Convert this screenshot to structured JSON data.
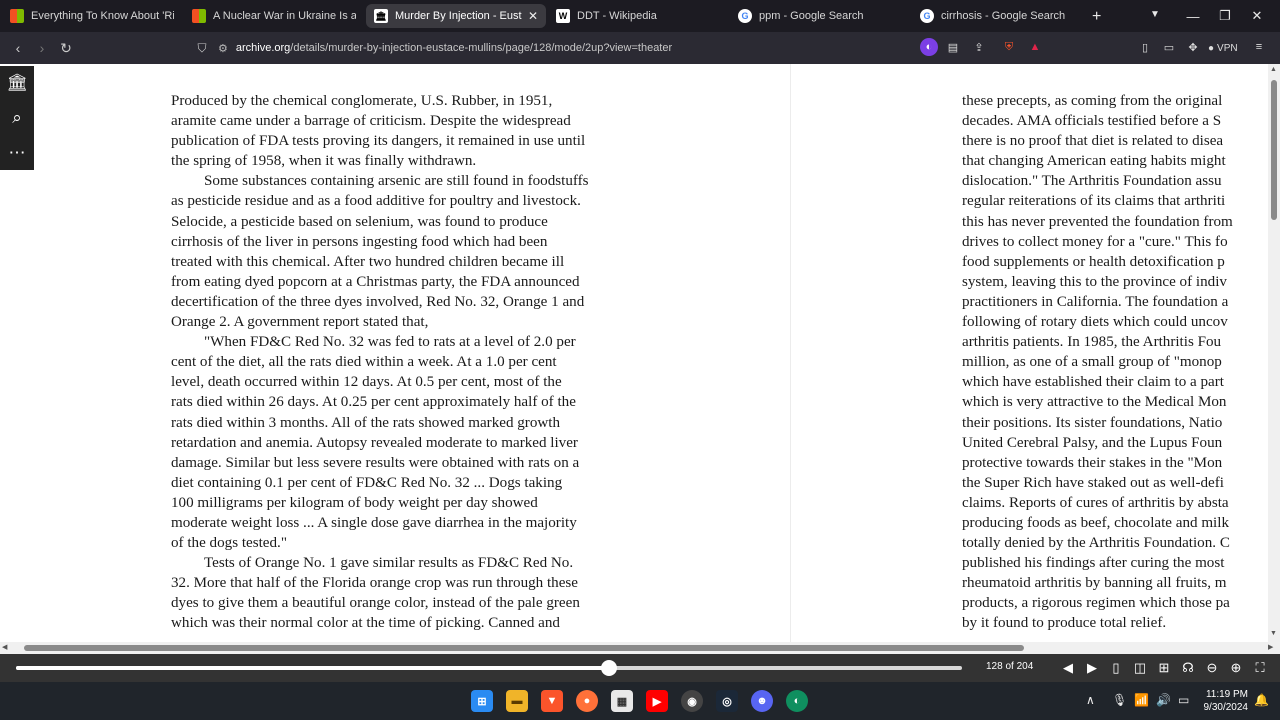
{
  "tabs": [
    {
      "title": "Everything To Know About 'Ring",
      "icon": "windows-grid-icon",
      "color": "#f25022"
    },
    {
      "title": "A Nuclear War in Ukraine Is a Dis",
      "icon": "windows-grid-icon",
      "color": "#f25022"
    },
    {
      "title": "Murder By Injection - Eusta",
      "icon": "archive-icon",
      "color": "#ffffff",
      "active": true
    },
    {
      "title": "DDT - Wikipedia",
      "icon": "wikipedia-icon",
      "color": "#ffffff"
    },
    {
      "title": "ppm - Google Search",
      "icon": "google-icon",
      "color": "#ffffff"
    },
    {
      "title": "cirrhosis - Google Search",
      "icon": "google-icon",
      "color": "#ffffff"
    }
  ],
  "address": {
    "host": "archive.org",
    "path": "/details/murder-by-injection-eustace-mullins/page/128/mode/2up?view=theater"
  },
  "extensions": {
    "vpn_label": "VPN"
  },
  "left_page": {
    "paragraphs": [
      {
        "indent": false,
        "lines": [
          "Produced by the chemical conglomerate, U.S. Rubber, in 1951,",
          "aramite came under a barrage of criticism. Despite the widespread",
          "publication of FDA tests proving its dangers, it remained in use until",
          "the spring of 1958, when it was finally withdrawn."
        ]
      },
      {
        "indent": true,
        "lines": [
          "Some substances containing arsenic are still found in foodstuffs",
          "as pesticide residue and as a food additive for poultry and livestock.",
          "Selocide, a pesticide based on selenium, was found to produce",
          "cirrhosis of the liver in persons ingesting food which had been",
          "treated with this chemical. After two hundred children became ill",
          "from eating dyed popcorn at a Christmas party, the FDA announced",
          "decertification of the three dyes involved, Red No. 32, Orange 1 and",
          "Orange 2. A government report stated that,"
        ]
      },
      {
        "indent": true,
        "lines": [
          "\"When FD&C Red No. 32 was fed to rats at a level of 2.0 per",
          "cent of the diet, all the rats died within a week. At a 1.0 per cent",
          "level, death occurred within 12 days. At 0.5 per cent, most of the",
          "rats died within 26 days. At 0.25 per cent approximately half of the",
          "rats died within 3 months. All of the rats showed marked growth",
          "retardation and anemia. Autopsy revealed moderate to marked liver",
          "damage. Similar but less severe results were obtained with rats on a",
          "diet containing 0.1 per cent of FD&C Red No. 32 ... Dogs taking",
          "100 milligrams per kilogram of body weight per day showed",
          "moderate weight loss ... A single dose gave diarrhea in the majority",
          "of the dogs tested.\""
        ]
      },
      {
        "indent": true,
        "lines": [
          "Tests of Orange No. 1 gave similar results as FD&C Red No.",
          "32. More that half of the Florida orange crop was run through these",
          "dyes to give them a beautiful orange color, instead of the pale green",
          "which was their normal color at the time of picking. Canned and"
        ]
      }
    ]
  },
  "right_page": {
    "lines": [
      "these precepts, as coming from the original",
      "decades. AMA officials testified before a S",
      "there is no proof that diet is related to disea",
      "that changing American eating habits might",
      "dislocation.\" The Arthritis Foundation assu",
      "regular reiterations of its claims that arthriti",
      "this has never prevented the foundation from",
      "drives to collect money for a \"cure.\" This fo",
      "food supplements or health detoxification p",
      "system, leaving this to the province of indiv",
      "practitioners in California. The foundation a",
      "following of rotary diets which could uncov",
      "arthritis patients. In 1985, the Arthritis Fou",
      "million, as one of a small group of \"monop",
      "which have established their claim to a part",
      "which is very attractive to the Medical Mon",
      "their positions. Its sister foundations, Natio",
      "United Cerebral Palsy, and the Lupus Foun",
      "protective towards their stakes in the \"Mon",
      "the Super Rich have staked out as well-defi",
      "claims. Reports of cures of arthritis by absta",
      "producing foods as beef, chocolate and milk",
      "totally denied by the Arthritis Foundation. C",
      "published his findings after curing the most",
      "rheumatoid arthritis by banning all fruits, m",
      "products, a rigorous regimen which those pa",
      "by it found to produce total relief."
    ]
  },
  "viewer": {
    "current_page": 128,
    "total_pages": 204,
    "page_label": "128 of 204",
    "progress": 0.627
  },
  "clock": {
    "time": "11:19 PM",
    "date": "9/30/2024"
  }
}
